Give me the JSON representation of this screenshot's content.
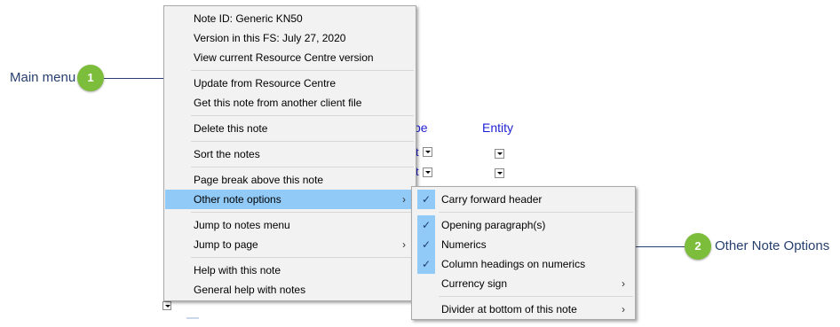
{
  "callouts": [
    {
      "number": "1",
      "label": "Main menu"
    },
    {
      "number": "2",
      "label": "Other Note Options"
    }
  ],
  "background": {
    "col_type_fragment": "pe",
    "col_entity": "Entity",
    "t_fragment": "t"
  },
  "main_menu": {
    "items": [
      {
        "label": "Note ID: Generic KN50"
      },
      {
        "label": "Version in this FS: July 27, 2020"
      },
      {
        "label": "View current Resource Centre version"
      },
      {
        "label": "Update from Resource Centre"
      },
      {
        "label": "Get this note from another client file"
      },
      {
        "label": "Delete this note"
      },
      {
        "label": "Sort the notes"
      },
      {
        "label": "Page break above this note"
      },
      {
        "label": "Other note options",
        "submenu": true,
        "highlighted": true
      },
      {
        "label": "Jump to notes menu"
      },
      {
        "label": "Jump to page",
        "submenu": true
      },
      {
        "label": "Help with this note"
      },
      {
        "label": "General help with notes"
      }
    ]
  },
  "other_note_options_menu": {
    "items": [
      {
        "label": "Carry forward header",
        "checked": true
      },
      {
        "label": "Opening paragraph(s)",
        "checked": true
      },
      {
        "label": "Numerics",
        "checked": true
      },
      {
        "label": "Column headings on numerics",
        "checked": true
      },
      {
        "label": "Currency sign",
        "checked": false,
        "submenu": true
      },
      {
        "label": "Divider at bottom of this note",
        "checked": false,
        "submenu": true
      }
    ]
  },
  "icons": {
    "check": "✓",
    "submenu_arrow": "›"
  },
  "colors": {
    "highlight": "#91c9f7",
    "badge": "#7cbd3b",
    "callout_text": "#28406f",
    "form_link": "#1f1fd6"
  }
}
